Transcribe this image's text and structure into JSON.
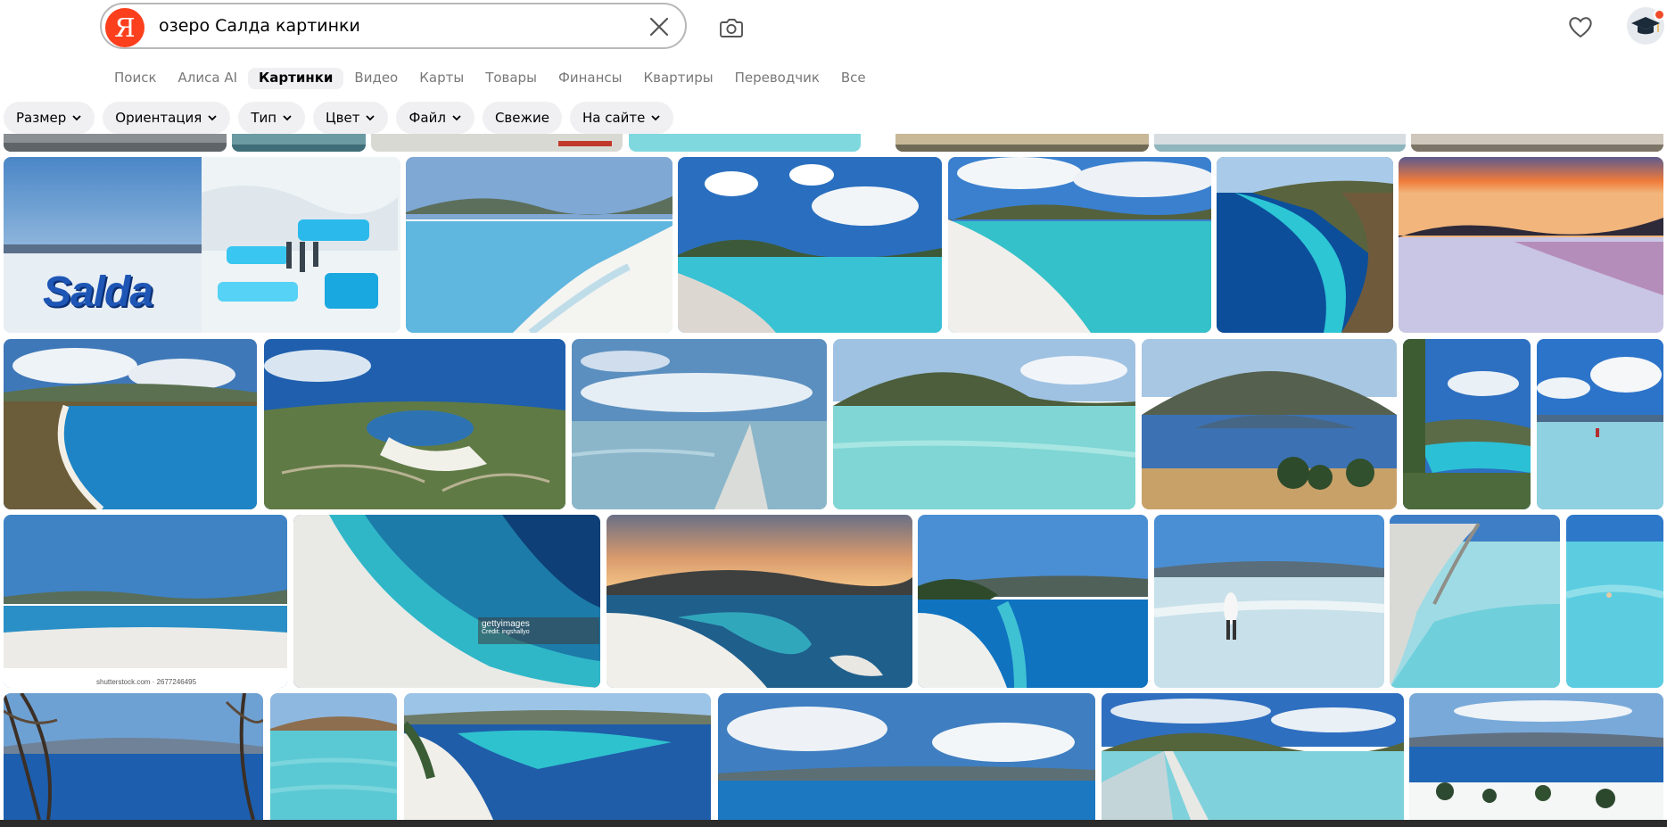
{
  "search": {
    "logo_letter": "Я",
    "query": "озеро Салда картинки"
  },
  "icons": {
    "clear": "close-icon",
    "camera": "camera-icon",
    "favorites": "heart-icon",
    "avatar": "graduation-cap-icon",
    "chevron": "chevron-down-icon"
  },
  "tabs": [
    {
      "label": "Поиск",
      "active": false
    },
    {
      "label": "Алиса AI",
      "active": false
    },
    {
      "label": "Картинки",
      "active": true
    },
    {
      "label": "Видео",
      "active": false
    },
    {
      "label": "Карты",
      "active": false
    },
    {
      "label": "Товары",
      "active": false
    },
    {
      "label": "Финансы",
      "active": false
    },
    {
      "label": "Квартиры",
      "active": false
    },
    {
      "label": "Переводчик",
      "active": false
    },
    {
      "label": "Все",
      "active": false
    }
  ],
  "filters": [
    {
      "label": "Размер",
      "dropdown": true
    },
    {
      "label": "Ориентация",
      "dropdown": true
    },
    {
      "label": "Тип",
      "dropdown": true
    },
    {
      "label": "Цвет",
      "dropdown": true
    },
    {
      "label": "Файл",
      "dropdown": true
    },
    {
      "label": "Свежие",
      "dropdown": false
    },
    {
      "label": "На сайте",
      "dropdown": true
    }
  ],
  "overlays": {
    "salda_word": "Salda",
    "getty_line1": "gettyimages",
    "getty_line2": "Credit: ingshallyo",
    "shutterstock": "shutterstock.com · 2677246495"
  },
  "colors": {
    "brand_red": "#fc3f1d",
    "chip_bg": "#f0f0f2",
    "tab_inactive": "#787878"
  }
}
